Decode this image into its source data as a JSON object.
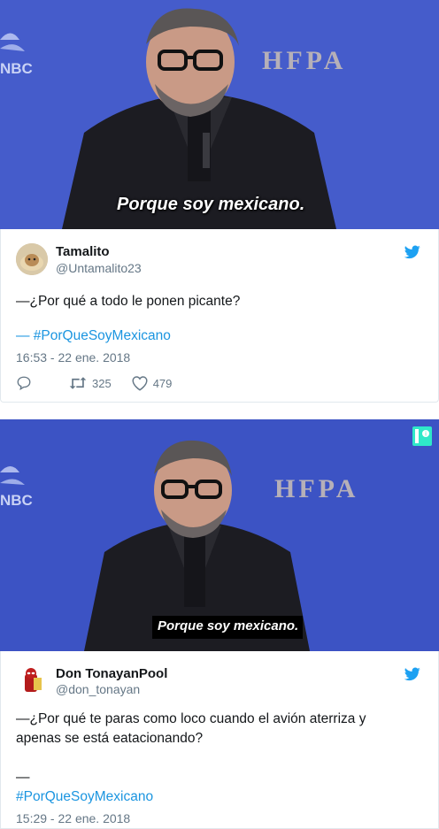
{
  "scene1": {
    "subtitle": "Porque soy mexicano.",
    "logo": "HFPA",
    "network": "NBC"
  },
  "tweet1": {
    "name": "Tamalito",
    "handle": "@Untamalito23",
    "text": "—¿Por qué a todo le ponen picante?",
    "hashtag": "— #PorQueSoyMexicano",
    "time": "16:53 - 22 ene. 2018",
    "retweets": "325",
    "likes": "479",
    "icons": {
      "reply": "reply-icon",
      "retweet": "retweet-icon",
      "like": "heart-icon",
      "brand": "twitter-bird-icon"
    }
  },
  "scene2": {
    "subtitle": "Porque soy mexicano.",
    "logo": "HFPA",
    "network": "NBC",
    "info_badge": "i"
  },
  "tweet2": {
    "name": "Don TonayanPool",
    "handle": "@don_tonayan",
    "text": "—¿Por qué te paras como loco cuando el avión aterriza y apenas se está eatacionando?",
    "dash": "—",
    "hashtag": "#PorQueSoyMexicano",
    "time": "15:29 - 22 ene. 2018"
  },
  "colors": {
    "link": "#1b95e0",
    "muted": "#657786",
    "backdrop": "#3f56c7",
    "badge": "#2fe8c9"
  }
}
